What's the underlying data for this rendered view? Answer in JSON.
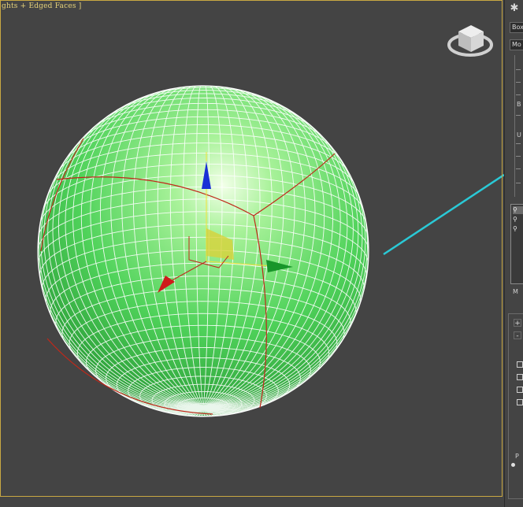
{
  "viewport": {
    "label": "ghts + Edged Faces ]",
    "sphere_color": "#3fd24a",
    "wire_color": "#ffffff",
    "accent_line_color": "#2ac9d6"
  },
  "command_panel": {
    "gear_icon": "gear-icon",
    "object_name": "Box",
    "modifier_list": "Mo",
    "section_label_u": "U",
    "section_label_b": "B",
    "stack_items": [
      {
        "icon": "light-bulb-icon",
        "label": "⚲"
      },
      {
        "icon": "light-bulb-icon",
        "label": "⚲"
      },
      {
        "icon": "light-bulb-icon",
        "label": "⚲"
      }
    ],
    "pin_label": "M",
    "plus_label": "+",
    "minus_label": "-",
    "param_label": "P"
  }
}
